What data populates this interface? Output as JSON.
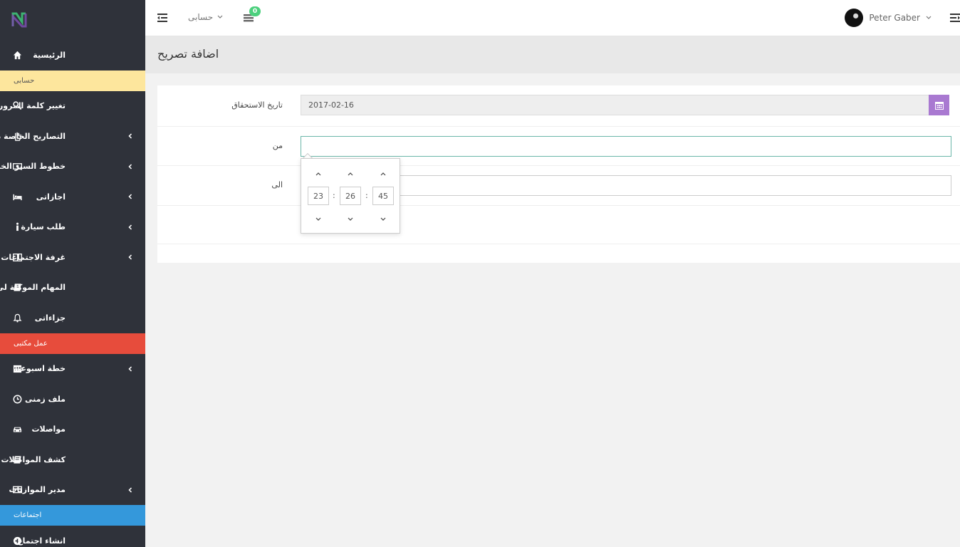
{
  "sidebar": {
    "items": [
      {
        "label": "الرئيسية",
        "icon": "home-icon",
        "arrow": false
      },
      {
        "section": "حسابى",
        "style": "yellow"
      },
      {
        "label": "تغيير كلمة المرور",
        "icon": "key-icon",
        "arrow": false
      },
      {
        "label": "التصاريح الخاصة بى",
        "icon": "hand-icon",
        "arrow": true
      },
      {
        "label": "خطوط السير الخاصة بى",
        "icon": "money-icon",
        "arrow": true
      },
      {
        "label": "اجازاتى",
        "icon": "bed-icon",
        "arrow": true
      },
      {
        "label": "طلب سيارة",
        "icon": "info-icon",
        "arrow": true
      },
      {
        "label": "غرفة الاجتماعات",
        "icon": "columns-icon",
        "arrow": true
      },
      {
        "label": "المهام الموكلة لى",
        "icon": "book-icon",
        "arrow": false
      },
      {
        "label": "جزاءاتى",
        "icon": "bell-icon",
        "arrow": false
      },
      {
        "section": "عمل مكتبى",
        "style": "red"
      },
      {
        "label": "خطة اسبوعية",
        "icon": "calendar-icon",
        "arrow": true
      },
      {
        "label": "ملف زمنى",
        "icon": "clock-icon",
        "arrow": false
      },
      {
        "label": "مواصلات",
        "icon": "car-icon",
        "arrow": false
      },
      {
        "label": "كشف المواصلات",
        "icon": "book-icon",
        "arrow": false
      },
      {
        "label": "مدير الموازنات",
        "icon": "credit-card-icon",
        "arrow": true
      },
      {
        "section": "اجتماعات",
        "style": "blue"
      },
      {
        "label": "انشاء اجتماع",
        "icon": "plus-circle-icon",
        "arrow": false
      }
    ]
  },
  "topbar": {
    "account_label": "حسابى",
    "notification_count": "0",
    "user_name": "Peter Gaber"
  },
  "page": {
    "title": "اضافة تصريح"
  },
  "form": {
    "due_date_label": "تاريخ الاستحقاق",
    "due_date_value": "2017-02-16",
    "from_label": "من",
    "to_label": "الى"
  },
  "timepicker": {
    "hours": "23",
    "minutes": "26",
    "seconds": "45",
    "separator": ":"
  },
  "colors": {
    "sidebar_bg": "#2f323a",
    "section_yellow": "#fde69d",
    "section_red": "#e74c3c",
    "section_blue": "#3498db",
    "date_button": "#a979d1",
    "badge": "#4cd07d"
  }
}
